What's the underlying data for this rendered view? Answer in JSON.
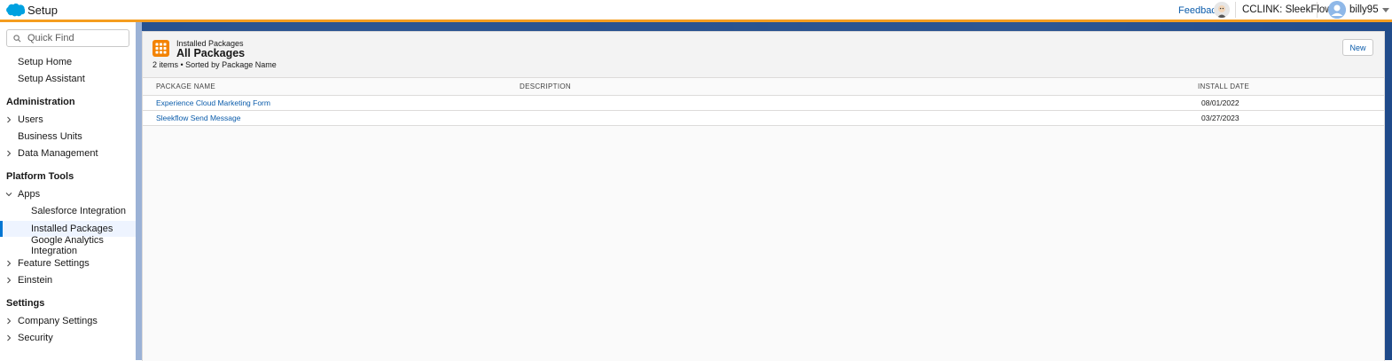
{
  "header": {
    "app_name": "Setup",
    "feedback_label": "Feedback",
    "org_label": "CCLINK: SleekFlow",
    "user_name": "billy95",
    "brand_color": "#00a1e0",
    "accent_color": "#f59d1f"
  },
  "sidebar": {
    "quickfind_placeholder": "Quick Find",
    "items_top": [
      {
        "label": "Setup Home"
      },
      {
        "label": "Setup Assistant"
      }
    ],
    "sections": {
      "administration": "Administration",
      "platform_tools": "Platform Tools",
      "settings": "Settings"
    },
    "admin_items": [
      {
        "label": "Users",
        "expandable": true
      },
      {
        "label": "Business Units",
        "expandable": false
      },
      {
        "label": "Data Management",
        "expandable": true
      }
    ],
    "platform_items": [
      {
        "label": "Apps",
        "expanded": true
      },
      {
        "label": "Salesforce Integration",
        "child": true
      },
      {
        "label": "Installed Packages",
        "child": true,
        "active": true
      },
      {
        "label": "Google Analytics Integration",
        "child": true
      },
      {
        "label": "Feature Settings",
        "expandable": true
      },
      {
        "label": "Einstein",
        "expandable": true
      }
    ],
    "settings_items": [
      {
        "label": "Company Settings",
        "expandable": true
      },
      {
        "label": "Security",
        "expandable": true
      }
    ]
  },
  "page": {
    "breadcrumb": "Installed Packages",
    "title": "All Packages",
    "subtitle": "2 items • Sorted by Package Name",
    "new_button": "New",
    "columns": [
      "PACKAGE NAME",
      "DESCRIPTION",
      "INSTALL DATE"
    ],
    "rows": [
      {
        "name": "Experience Cloud Marketing Form",
        "description": "",
        "install_date": "08/01/2022"
      },
      {
        "name": "Sleekflow Send Message",
        "description": "",
        "install_date": "03/27/2023"
      }
    ]
  }
}
